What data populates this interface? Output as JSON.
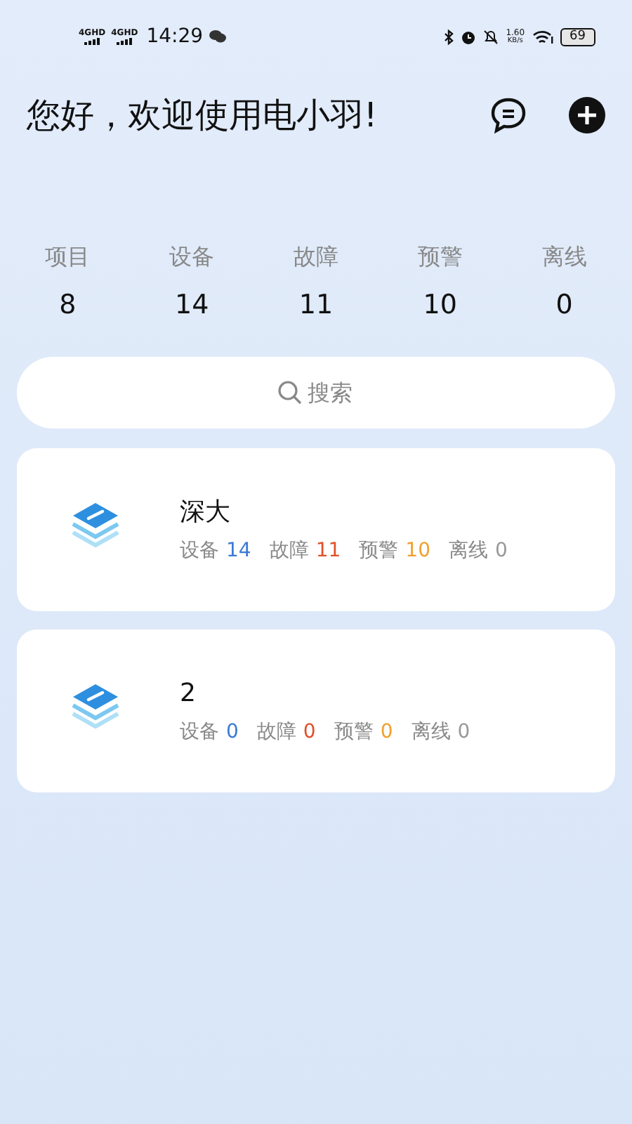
{
  "status_bar": {
    "signals": [
      "4GHD",
      "4GHD"
    ],
    "time": "14:29",
    "speed": "1.60",
    "speed_unit": "KB/s",
    "battery": "69"
  },
  "greeting": "您好，欢迎使用电小羽!",
  "summary": [
    {
      "label": "项目",
      "value": "8"
    },
    {
      "label": "设备",
      "value": "14"
    },
    {
      "label": "故障",
      "value": "11"
    },
    {
      "label": "预警",
      "value": "10"
    },
    {
      "label": "离线",
      "value": "0"
    }
  ],
  "search": {
    "placeholder": "搜索"
  },
  "projects": [
    {
      "name": "深大",
      "stats": [
        {
          "label": "设备",
          "value": "14",
          "color": "#3a7bd5"
        },
        {
          "label": "故障",
          "value": "11",
          "color": "#e0502a"
        },
        {
          "label": "预警",
          "value": "10",
          "color": "#f0a030"
        },
        {
          "label": "离线",
          "value": "0",
          "color": "#999999"
        }
      ]
    },
    {
      "name": "2",
      "stats": [
        {
          "label": "设备",
          "value": "0",
          "color": "#3a7bd5"
        },
        {
          "label": "故障",
          "value": "0",
          "color": "#e0502a"
        },
        {
          "label": "预警",
          "value": "0",
          "color": "#f0a030"
        },
        {
          "label": "离线",
          "value": "0",
          "color": "#999999"
        }
      ]
    }
  ]
}
